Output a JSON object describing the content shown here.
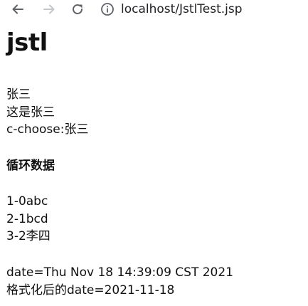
{
  "browser": {
    "url": "localhost/JstlTest.jsp"
  },
  "icons": {
    "back": "arrow-left-icon",
    "forward": "arrow-right-icon",
    "reload": "reload-icon",
    "info": "info-circle-icon"
  },
  "page": {
    "title": "jstl",
    "names": [
      "张三",
      "这是张三",
      "c-choose:张三"
    ],
    "loop_heading": "循环数据",
    "loop_items": [
      "1-0abc",
      "2-1bcd",
      "3-2李四"
    ],
    "date_raw": "date=Thu Nov 18 14:39:09 CST 2021",
    "date_formatted": "格式化后的date=2021-11-18"
  }
}
